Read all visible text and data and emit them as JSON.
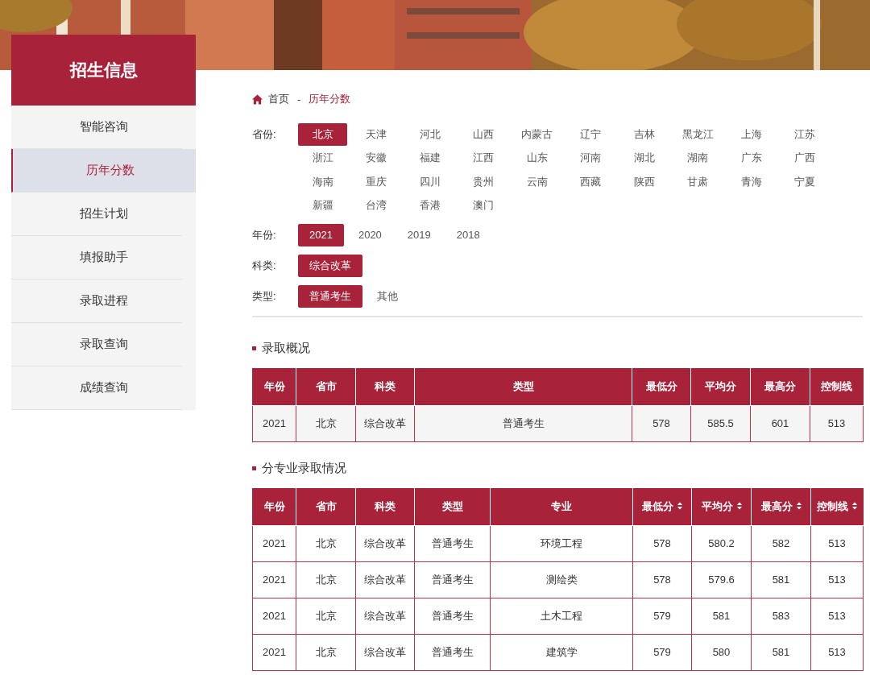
{
  "sidebar": {
    "title": "招生信息",
    "items": [
      {
        "label": "智能咨询",
        "selected": false
      },
      {
        "label": "历年分数",
        "selected": true
      },
      {
        "label": "招生计划",
        "selected": false
      },
      {
        "label": "填报助手",
        "selected": false
      },
      {
        "label": "录取进程",
        "selected": false
      },
      {
        "label": "录取查询",
        "selected": false
      },
      {
        "label": "成绩查询",
        "selected": false
      }
    ]
  },
  "breadcrumb": {
    "home": "首页",
    "separator": "-",
    "current": "历年分数"
  },
  "filters": [
    {
      "label": "省份:",
      "options": [
        {
          "label": "北京",
          "selected": true
        },
        {
          "label": "天津",
          "selected": false
        },
        {
          "label": "河北",
          "selected": false
        },
        {
          "label": "山西",
          "selected": false
        },
        {
          "label": "内蒙古",
          "selected": false
        },
        {
          "label": "辽宁",
          "selected": false
        },
        {
          "label": "吉林",
          "selected": false
        },
        {
          "label": "黑龙江",
          "selected": false
        },
        {
          "label": "上海",
          "selected": false
        },
        {
          "label": "江苏",
          "selected": false
        },
        {
          "label": "浙江",
          "selected": false
        },
        {
          "label": "安徽",
          "selected": false
        },
        {
          "label": "福建",
          "selected": false
        },
        {
          "label": "江西",
          "selected": false
        },
        {
          "label": "山东",
          "selected": false
        },
        {
          "label": "河南",
          "selected": false
        },
        {
          "label": "湖北",
          "selected": false
        },
        {
          "label": "湖南",
          "selected": false
        },
        {
          "label": "广东",
          "selected": false
        },
        {
          "label": "广西",
          "selected": false
        },
        {
          "label": "海南",
          "selected": false
        },
        {
          "label": "重庆",
          "selected": false
        },
        {
          "label": "四川",
          "selected": false
        },
        {
          "label": "贵州",
          "selected": false
        },
        {
          "label": "云南",
          "selected": false
        },
        {
          "label": "西藏",
          "selected": false
        },
        {
          "label": "陕西",
          "selected": false
        },
        {
          "label": "甘肃",
          "selected": false
        },
        {
          "label": "青海",
          "selected": false
        },
        {
          "label": "宁夏",
          "selected": false
        },
        {
          "label": "新疆",
          "selected": false
        },
        {
          "label": "台湾",
          "selected": false
        },
        {
          "label": "香港",
          "selected": false
        },
        {
          "label": "澳门",
          "selected": false
        }
      ]
    },
    {
      "label": "年份:",
      "options": [
        {
          "label": "2021",
          "selected": true
        },
        {
          "label": "2020",
          "selected": false
        },
        {
          "label": "2019",
          "selected": false
        },
        {
          "label": "2018",
          "selected": false
        }
      ]
    },
    {
      "label": "科类:",
      "options": [
        {
          "label": "综合改革",
          "selected": true
        }
      ]
    },
    {
      "label": "类型:",
      "options": [
        {
          "label": "普通考生",
          "selected": true
        },
        {
          "label": "其他",
          "selected": false
        }
      ]
    }
  ],
  "sections": [
    {
      "title": "录取概况",
      "table": {
        "columns": [
          {
            "label": "年份",
            "sortable": false
          },
          {
            "label": "省市",
            "sortable": false
          },
          {
            "label": "科类",
            "sortable": false
          },
          {
            "label": "类型",
            "sortable": false
          },
          {
            "label": "最低分",
            "sortable": false
          },
          {
            "label": "平均分",
            "sortable": false
          },
          {
            "label": "最高分",
            "sortable": false
          },
          {
            "label": "控制线",
            "sortable": false
          }
        ],
        "rows": [
          [
            "2021",
            "北京",
            "综合改革",
            "普通考生",
            "578",
            "585.5",
            "601",
            "513"
          ]
        ]
      }
    },
    {
      "title": "分专业录取情况",
      "table": {
        "columns": [
          {
            "label": "年份",
            "sortable": false
          },
          {
            "label": "省市",
            "sortable": false
          },
          {
            "label": "科类",
            "sortable": false
          },
          {
            "label": "类型",
            "sortable": false
          },
          {
            "label": "专业",
            "sortable": false
          },
          {
            "label": "最低分",
            "sortable": true
          },
          {
            "label": "平均分",
            "sortable": true
          },
          {
            "label": "最高分",
            "sortable": true
          },
          {
            "label": "控制线",
            "sortable": true
          }
        ],
        "rows": [
          [
            "2021",
            "北京",
            "综合改革",
            "普通考生",
            "环境工程",
            "578",
            "580.2",
            "582",
            "513"
          ],
          [
            "2021",
            "北京",
            "综合改革",
            "普通考生",
            "测绘类",
            "578",
            "579.6",
            "581",
            "513"
          ],
          [
            "2021",
            "北京",
            "综合改革",
            "普通考生",
            "土木工程",
            "579",
            "581",
            "583",
            "513"
          ],
          [
            "2021",
            "北京",
            "综合改革",
            "普通考生",
            "建筑学",
            "579",
            "580",
            "581",
            "513"
          ]
        ]
      }
    }
  ]
}
